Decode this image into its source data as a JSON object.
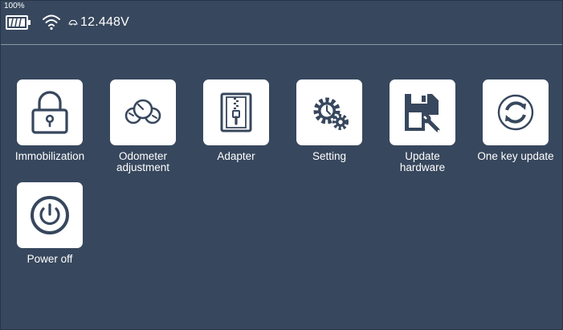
{
  "status": {
    "battery_percent": "100%",
    "voltage": "12.448V"
  },
  "apps": [
    {
      "label_line1": "Immobilization",
      "label_line2": "",
      "icon": "padlock-icon"
    },
    {
      "label_line1": "Odometer",
      "label_line2": "adjustment",
      "icon": "gauges-icon"
    },
    {
      "label_line1": "Adapter",
      "label_line2": "",
      "icon": "zipper-adapter-icon"
    },
    {
      "label_line1": "Setting",
      "label_line2": "",
      "icon": "gears-icon"
    },
    {
      "label_line1": "Update",
      "label_line2": "hardware",
      "icon": "floppy-wrench-icon"
    },
    {
      "label_line1": "One key update",
      "label_line2": "",
      "icon": "refresh-icon"
    },
    {
      "label_line1": "Power off",
      "label_line2": "",
      "icon": "power-icon"
    }
  ],
  "colors": {
    "background": "#37475d",
    "tile": "#ffffff",
    "icon": "#37475d",
    "text": "#ffffff"
  }
}
